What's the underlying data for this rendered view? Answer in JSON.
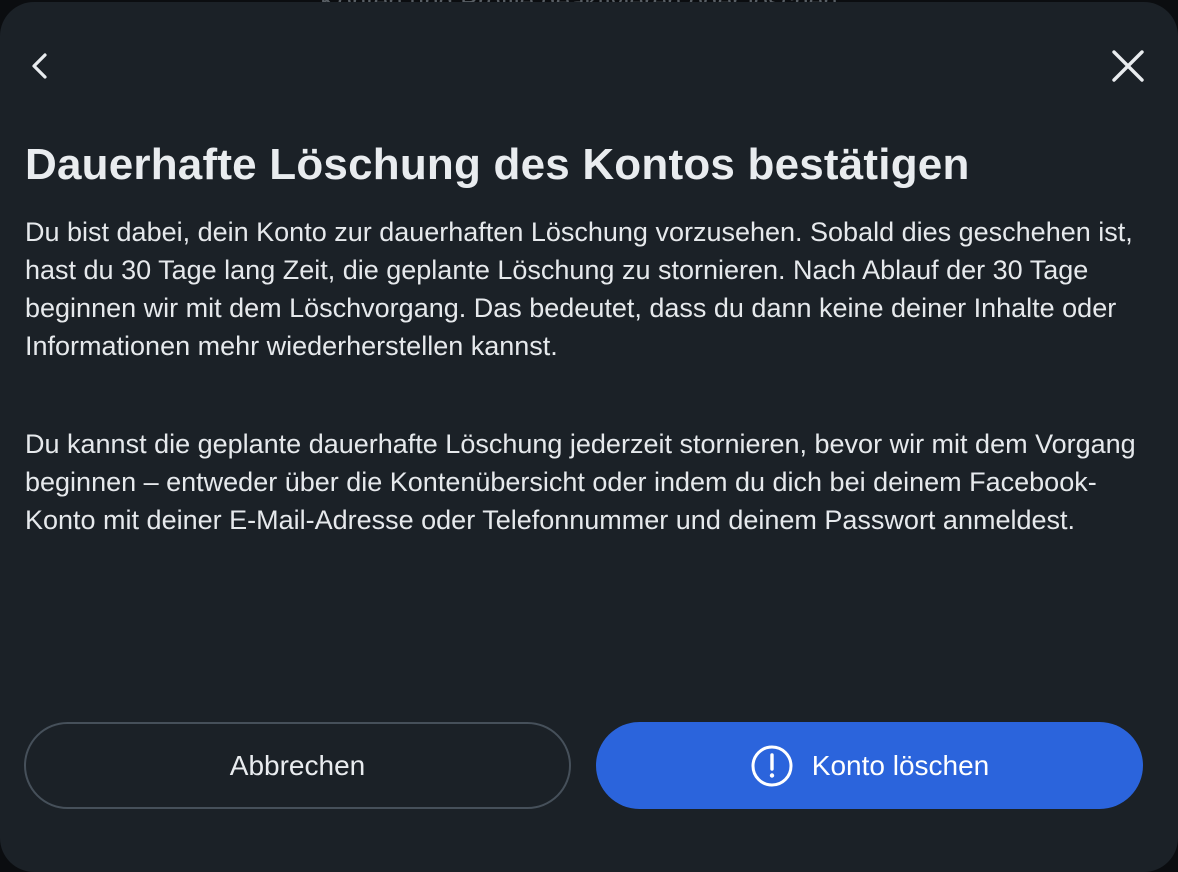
{
  "backdrop": {
    "partial_text": "Konten und Profile deaktivieren oder löschen"
  },
  "dialog": {
    "back_icon": "chevron-left-icon",
    "close_icon": "close-icon",
    "title": "Dauerhafte Löschung des Kontos bestätigen",
    "paragraphs": [
      "Du bist dabei, dein Konto zur dauerhaften Löschung vorzusehen. Sobald dies geschehen ist, hast du 30 Tage lang Zeit, die geplante Löschung zu stornieren. Nach Ablauf der 30 Tage beginnen wir mit dem Löschvorgang. Das bedeutet, dass du dann keine deiner Inhalte oder Informationen mehr wiederherstellen kannst.",
      "Du kannst die geplante dauerhafte Löschung jederzeit stornieren, bevor wir mit dem Vorgang beginnen – entweder über die Kontenübersicht oder indem du dich bei deinem Facebook-Konto mit deiner E-Mail-Adresse oder Telefonnummer und deinem Passwort anmeldest."
    ],
    "cancel_label": "Abbrechen",
    "delete_label": "Konto löschen",
    "delete_icon": "exclamation-circle-icon"
  },
  "colors": {
    "dialog_bg": "#1b2127",
    "primary_button": "#2b64dc",
    "text": "#e6e9ec",
    "outline": "#46505a"
  }
}
